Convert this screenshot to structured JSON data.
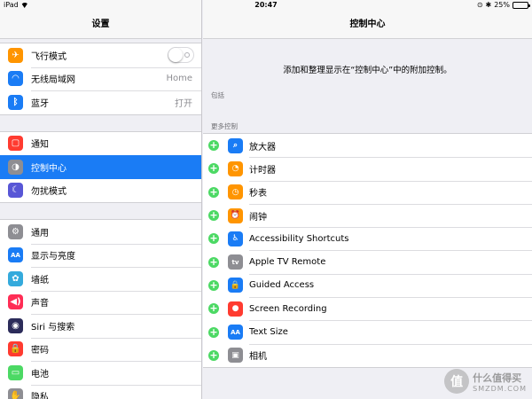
{
  "status_bar": {
    "device": "iPad",
    "time": "20:47",
    "battery": "25%",
    "battery_level": 0.25
  },
  "sidebar": {
    "title": "设置",
    "groups": [
      [
        {
          "label": "飞行模式",
          "icon": "airplane-icon",
          "color": "#ff9500",
          "control": "toggle",
          "on": false
        },
        {
          "label": "无线局域网",
          "icon": "wifi-icon",
          "color": "#1a7cf5",
          "value": "Home"
        },
        {
          "label": "蓝牙",
          "icon": "bluetooth-icon",
          "color": "#1a7cf5",
          "value": "打开"
        }
      ],
      [
        {
          "label": "通知",
          "icon": "notifications-icon",
          "color": "#ff3b30"
        },
        {
          "label": "控制中心",
          "icon": "control-center-icon",
          "color": "#8e8e93",
          "selected": true
        },
        {
          "label": "勿扰模式",
          "icon": "moon-icon",
          "color": "#5856d6"
        }
      ],
      [
        {
          "label": "通用",
          "icon": "gear-icon",
          "color": "#8e8e93"
        },
        {
          "label": "显示与亮度",
          "icon": "display-icon",
          "color": "#1a7cf5"
        },
        {
          "label": "墙纸",
          "icon": "wallpaper-icon",
          "color": "#34aadc"
        },
        {
          "label": "声音",
          "icon": "sound-icon",
          "color": "#ff2d55"
        },
        {
          "label": "Siri 与搜索",
          "icon": "siri-icon",
          "color": "#2c2c5a"
        },
        {
          "label": "密码",
          "icon": "lock-icon",
          "color": "#ff3b30"
        },
        {
          "label": "电池",
          "icon": "battery-icon",
          "color": "#4cd964"
        },
        {
          "label": "隐私",
          "icon": "hand-icon",
          "color": "#8e8e93"
        }
      ]
    ]
  },
  "detail": {
    "title": "控制中心",
    "description": "添加和整理显示在“控制中心”中的附加控制。",
    "include_header": "包括",
    "more_header": "更多控制",
    "controls": [
      {
        "label": "放大器",
        "icon": "magnifier-icon",
        "color": "#1a7cf5"
      },
      {
        "label": "计时器",
        "icon": "timer-icon",
        "color": "#ff9500"
      },
      {
        "label": "秒表",
        "icon": "stopwatch-icon",
        "color": "#ff9500"
      },
      {
        "label": "闹钟",
        "icon": "alarm-icon",
        "color": "#ff9500"
      },
      {
        "label": "Accessibility Shortcuts",
        "icon": "accessibility-icon",
        "color": "#1a7cf5"
      },
      {
        "label": "Apple TV Remote",
        "icon": "tv-icon",
        "color": "#8e8e93",
        "glyph": "tv"
      },
      {
        "label": "Guided Access",
        "icon": "guided-access-lock-icon",
        "color": "#1a7cf5"
      },
      {
        "label": "Screen Recording",
        "icon": "record-icon",
        "color": "#ff3b30"
      },
      {
        "label": "Text Size",
        "icon": "text-size-icon",
        "color": "#1a7cf5",
        "glyph": "AA"
      },
      {
        "label": "相机",
        "icon": "camera-icon",
        "color": "#8e8e93"
      }
    ]
  },
  "watermark": {
    "text": "什么值得买",
    "domain": "SMZDM.COM",
    "badge": "值"
  }
}
